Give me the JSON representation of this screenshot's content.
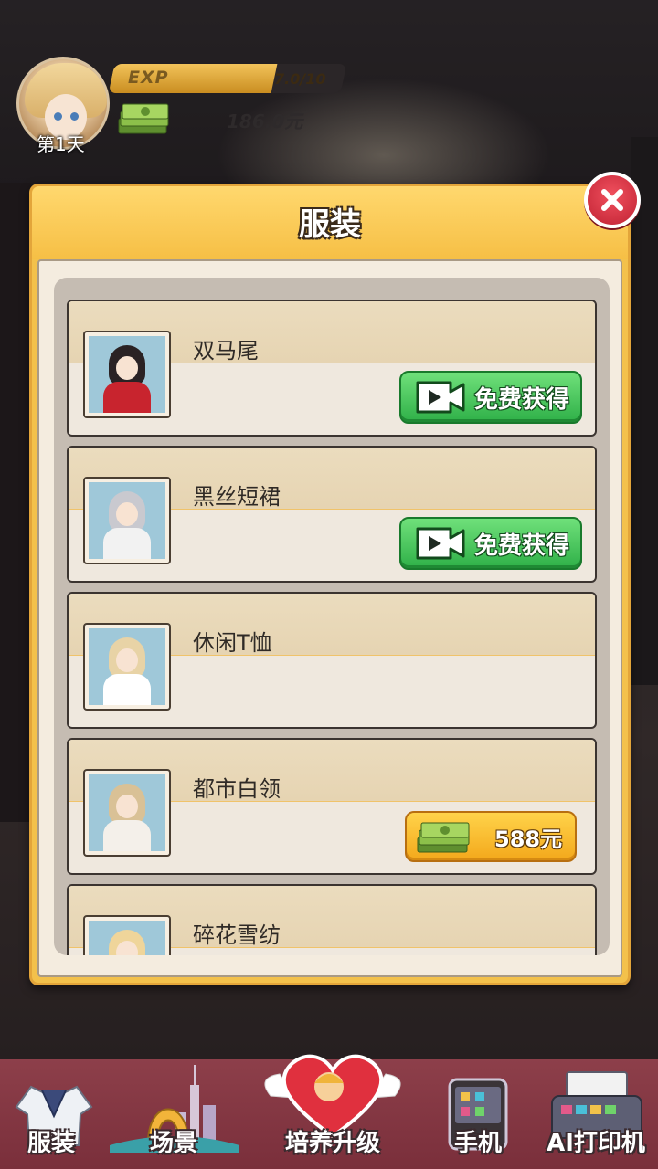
{
  "hud": {
    "day": "第1天",
    "exp_label": "EXP",
    "exp_value": "7.0/10",
    "exp_progress": 0.7,
    "money": "186.0元"
  },
  "dialog": {
    "title": "服装",
    "items": [
      {
        "name": "双马尾",
        "action": "free",
        "button_label": "免费获得",
        "hair_color": "#2a2224",
        "outfit_color": "#c8242e"
      },
      {
        "name": "黑丝短裙",
        "action": "free",
        "button_label": "免费获得",
        "hair_color": "#c9c9cf",
        "outfit_color": "#f2f2f2"
      },
      {
        "name": "休闲T恤",
        "action": "none",
        "button_label": "",
        "hair_color": "#e8d3a6",
        "outfit_color": "#ffffff"
      },
      {
        "name": "都市白领",
        "action": "price",
        "button_label": "588元",
        "hair_color": "#d9c196",
        "outfit_color": "#f4f0ea"
      },
      {
        "name": "碎花雪纺",
        "action": "none",
        "button_label": "",
        "hair_color": "#efd59a",
        "outfit_color": "#f7e7d8"
      }
    ]
  },
  "bottom_nav": [
    {
      "label": "服装",
      "icon": "uniform-icon"
    },
    {
      "label": "场景",
      "icon": "cityscape-icon"
    },
    {
      "label": "培养升级",
      "icon": "cupid-heart-icon"
    },
    {
      "label": "手机",
      "icon": "phone-icon"
    },
    {
      "label": "AI打印机",
      "icon": "printer-icon"
    }
  ],
  "colors": {
    "accent_gold": "#f3c14b",
    "button_green": "#2fb048",
    "button_orange": "#f3a81b",
    "close_red": "#c02233",
    "nav_bg": "#8d3f4a"
  }
}
